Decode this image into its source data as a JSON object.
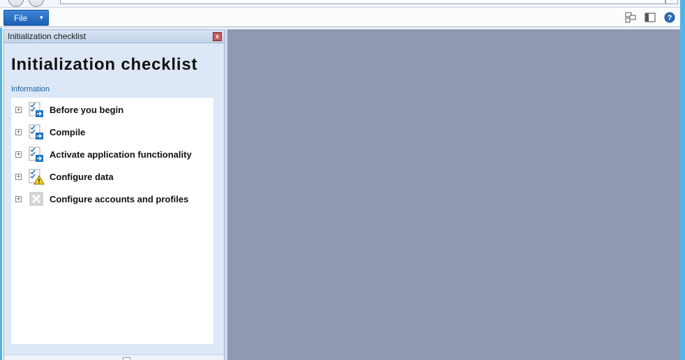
{
  "toolbar": {
    "file_label": "File",
    "file_arrow": "▼",
    "address_dropdown": "▾"
  },
  "pane": {
    "header": "Initialization checklist",
    "close_glyph": "x",
    "title": "Initialization checklist",
    "section_label": "Information",
    "items": [
      {
        "label": "Before you begin",
        "icon": "checklist-arrow-icon",
        "expander": "+"
      },
      {
        "label": "Compile",
        "icon": "checklist-arrow-icon",
        "expander": "+"
      },
      {
        "label": "Activate application functionality",
        "icon": "checklist-arrow-icon",
        "expander": "+"
      },
      {
        "label": "Configure data",
        "icon": "checklist-warning-icon",
        "expander": "+"
      },
      {
        "label": "Configure accounts and profiles",
        "icon": "disabled-x-icon",
        "expander": "+"
      }
    ]
  },
  "colors": {
    "file_button": "#2b6fc4",
    "workspace": "#9099b2",
    "pane_bg": "#dce8f7",
    "info_link": "#1a5fa0",
    "accent_edge": "#55b4e6"
  }
}
